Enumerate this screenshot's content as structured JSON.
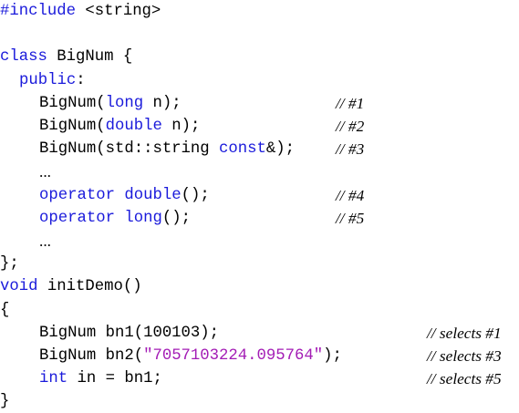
{
  "colors": {
    "keyword": "#1a1adb",
    "string": "#a31cb5",
    "text": "#000000"
  },
  "lines": [
    {
      "indent": 0,
      "tokens": [
        {
          "t": "#include",
          "k": "kw"
        },
        {
          "t": " <string>",
          "k": "tx"
        }
      ],
      "comment": ""
    },
    {
      "indent": 0,
      "tokens": [],
      "comment": ""
    },
    {
      "indent": 0,
      "tokens": [
        {
          "t": "class",
          "k": "kw"
        },
        {
          "t": " BigNum {",
          "k": "tx"
        }
      ],
      "comment": ""
    },
    {
      "indent": 1,
      "tokens": [
        {
          "t": "public",
          "k": "kw"
        },
        {
          "t": ":",
          "k": "tx"
        }
      ],
      "comment": ""
    },
    {
      "indent": 2,
      "tokens": [
        {
          "t": "BigNum(",
          "k": "tx"
        },
        {
          "t": "long",
          "k": "kw"
        },
        {
          "t": " n);",
          "k": "tx"
        }
      ],
      "comment": "// #1",
      "ccol": "mid"
    },
    {
      "indent": 2,
      "tokens": [
        {
          "t": "BigNum(",
          "k": "tx"
        },
        {
          "t": "double",
          "k": "kw"
        },
        {
          "t": " n);",
          "k": "tx"
        }
      ],
      "comment": "// #2",
      "ccol": "mid"
    },
    {
      "indent": 2,
      "tokens": [
        {
          "t": "BigNum(std::string ",
          "k": "tx"
        },
        {
          "t": "const",
          "k": "kw"
        },
        {
          "t": "&);",
          "k": "tx"
        }
      ],
      "comment": "// #3",
      "ccol": "mid"
    },
    {
      "indent": 2,
      "tokens": [
        {
          "t": "...",
          "k": "el"
        }
      ],
      "comment": ""
    },
    {
      "indent": 2,
      "tokens": [
        {
          "t": "operator",
          "k": "kw"
        },
        {
          "t": " ",
          "k": "tx"
        },
        {
          "t": "double",
          "k": "kw"
        },
        {
          "t": "();",
          "k": "tx"
        }
      ],
      "comment": "// #4",
      "ccol": "mid"
    },
    {
      "indent": 2,
      "tokens": [
        {
          "t": "operator",
          "k": "kw"
        },
        {
          "t": " ",
          "k": "tx"
        },
        {
          "t": "long",
          "k": "kw"
        },
        {
          "t": "();",
          "k": "tx"
        }
      ],
      "comment": "// #5",
      "ccol": "mid"
    },
    {
      "indent": 2,
      "tokens": [
        {
          "t": "...",
          "k": "el"
        }
      ],
      "comment": ""
    },
    {
      "indent": 0,
      "tokens": [
        {
          "t": "};",
          "k": "tx"
        }
      ],
      "comment": ""
    },
    {
      "indent": 0,
      "tokens": [
        {
          "t": "void",
          "k": "kw"
        },
        {
          "t": " initDemo()",
          "k": "tx"
        }
      ],
      "comment": ""
    },
    {
      "indent": 0,
      "tokens": [
        {
          "t": "{",
          "k": "tx"
        }
      ],
      "comment": ""
    },
    {
      "indent": 2,
      "tokens": [
        {
          "t": "BigNum bn1(100103);",
          "k": "tx"
        }
      ],
      "comment": "// selects #1",
      "ccol": "right"
    },
    {
      "indent": 2,
      "tokens": [
        {
          "t": "BigNum bn2(",
          "k": "tx"
        },
        {
          "t": "\"7057103224.095764\"",
          "k": "str"
        },
        {
          "t": ");",
          "k": "tx"
        }
      ],
      "comment": "// selects #3",
      "ccol": "right"
    },
    {
      "indent": 2,
      "tokens": [
        {
          "t": "int",
          "k": "kw"
        },
        {
          "t": " in = bn1;",
          "k": "tx"
        }
      ],
      "comment": "// selects #5",
      "ccol": "right"
    },
    {
      "indent": 0,
      "tokens": [
        {
          "t": "}",
          "k": "tx"
        }
      ],
      "comment": ""
    }
  ]
}
